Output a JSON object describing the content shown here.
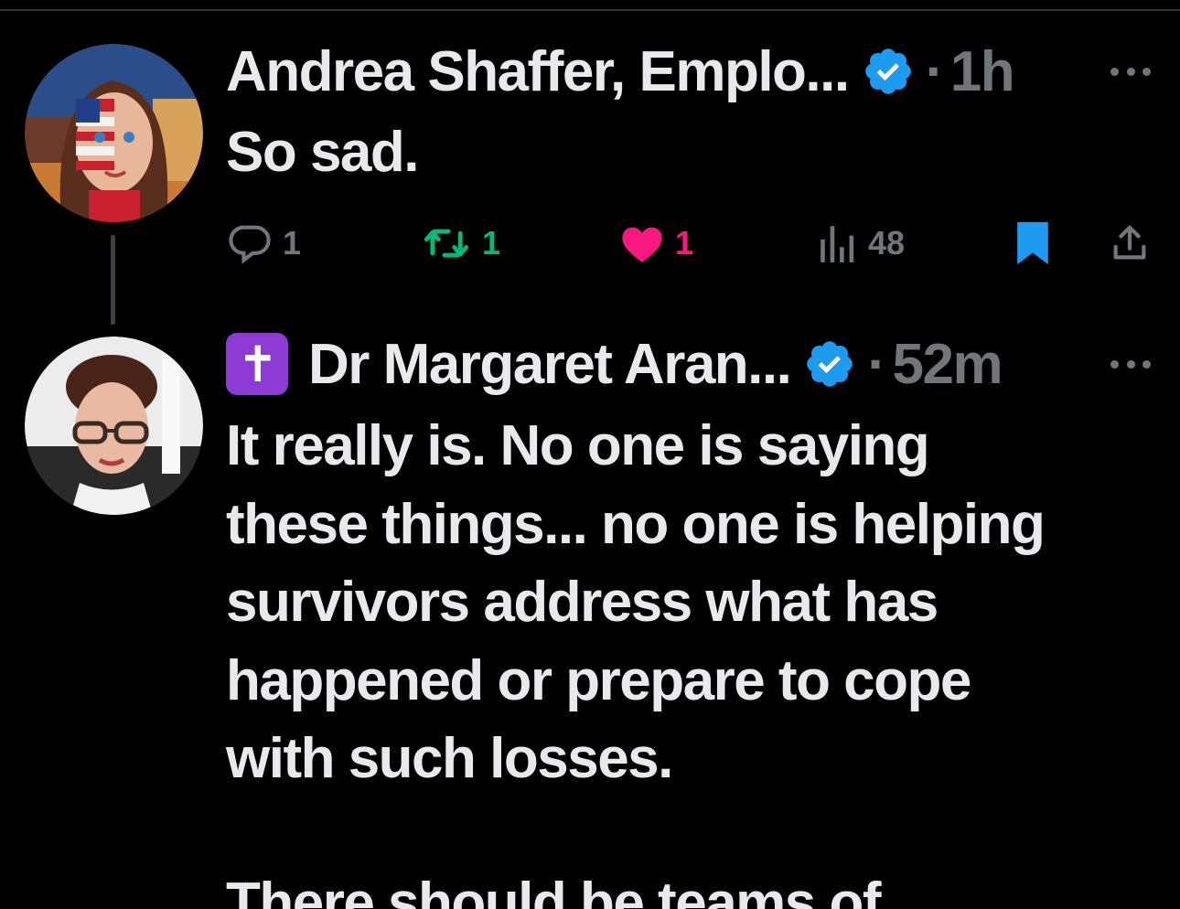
{
  "colors": {
    "background": "#000000",
    "text_primary": "#e7e9ea",
    "text_secondary": "#71767b",
    "verified_blue": "#1d9bf0",
    "retweet_green": "#00ba7c",
    "like_pink": "#f91880",
    "bookmark_blue": "#1d9bf0"
  },
  "tweets": [
    {
      "author": {
        "display_name": "Andrea Shaffer, Emplo...",
        "verified": true,
        "avatar_icon": "avatar-flag-portrait"
      },
      "separator": "·",
      "time": "1h",
      "text": "So sad.",
      "actions": {
        "replies": "1",
        "retweets": "1",
        "likes": "1",
        "liked": true,
        "views": "48",
        "bookmarked": true
      }
    },
    {
      "author": {
        "badge_emoji": "✝",
        "display_name": "Dr Margaret Aran...",
        "verified": true,
        "avatar_icon": "avatar-woman-glasses"
      },
      "separator": "·",
      "time": "52m",
      "text": "It really is. No one is saying\nthese things... no one is helping\nsurvivors address what has\nhappened or prepare to cope\nwith such losses.",
      "text_continued": "There should be teams of"
    }
  ]
}
